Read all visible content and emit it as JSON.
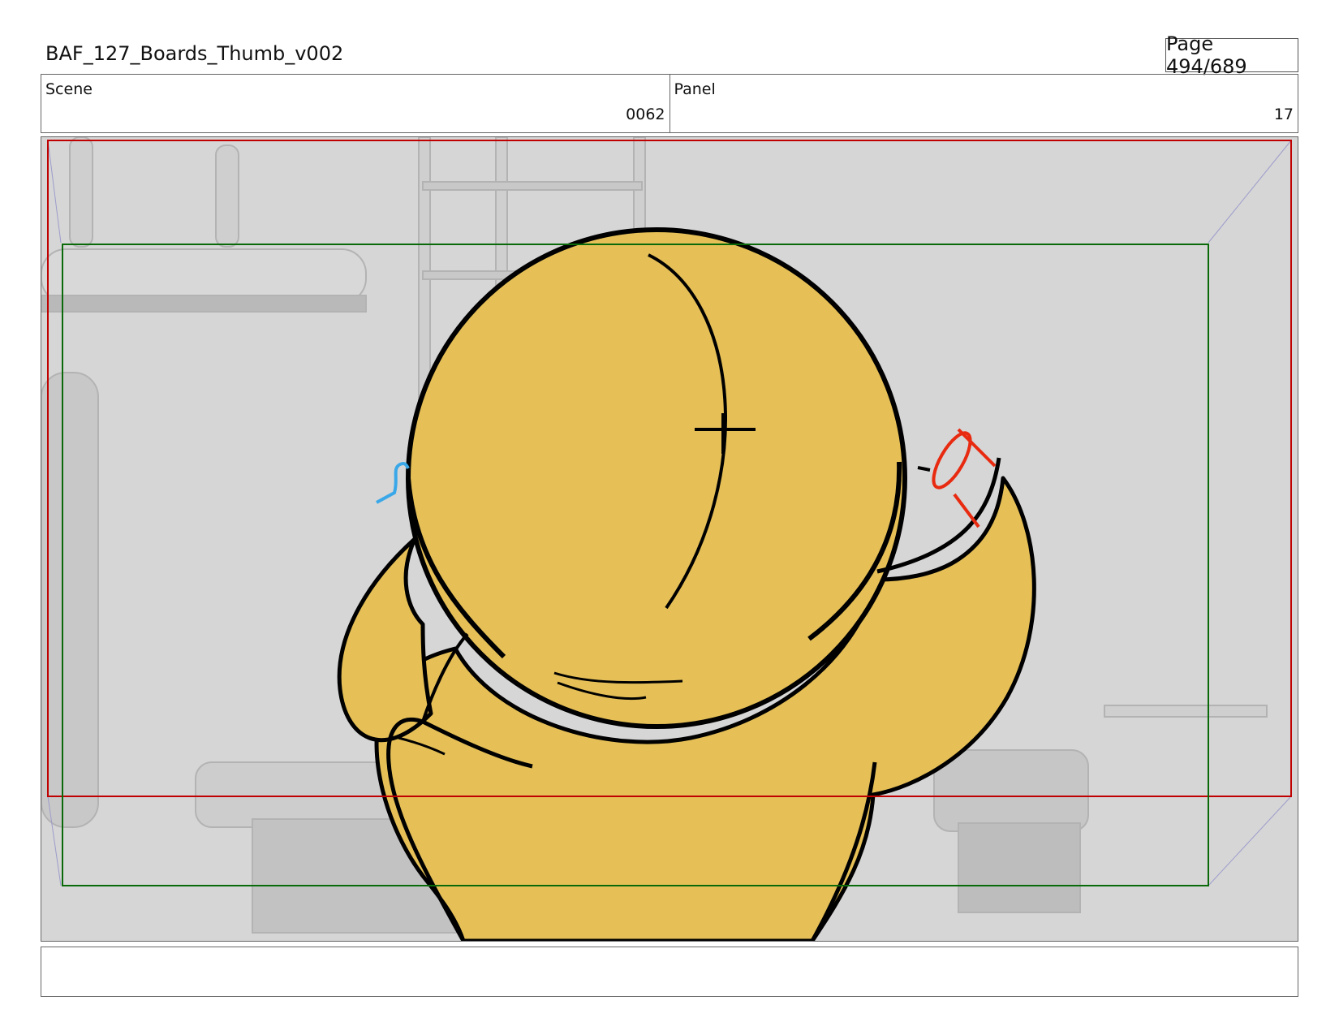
{
  "document": {
    "title": "BAF_127_Boards_Thumb_v002",
    "page": "Page 494/689"
  },
  "info": {
    "scene_label": "Scene",
    "scene_value": "0062",
    "panel_label": "Panel",
    "panel_value": "17"
  },
  "frame": {
    "safe_area_color": "#c00000",
    "action_area_color": "#0a6a0a",
    "character_fill": "#e6c057",
    "character_outline": "#000000",
    "left_mark_color": "#3aa8e8",
    "right_mark_color": "#e82a10",
    "background_color": "#d6d6d6"
  },
  "notes": {
    "text": ""
  }
}
